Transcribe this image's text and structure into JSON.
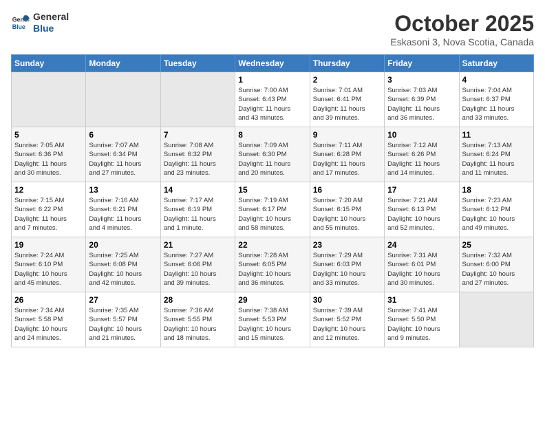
{
  "header": {
    "logo_line1": "General",
    "logo_line2": "Blue",
    "month": "October 2025",
    "location": "Eskasoni 3, Nova Scotia, Canada"
  },
  "days_of_week": [
    "Sunday",
    "Monday",
    "Tuesday",
    "Wednesday",
    "Thursday",
    "Friday",
    "Saturday"
  ],
  "weeks": [
    [
      {
        "day": "",
        "info": ""
      },
      {
        "day": "",
        "info": ""
      },
      {
        "day": "",
        "info": ""
      },
      {
        "day": "1",
        "info": "Sunrise: 7:00 AM\nSunset: 6:43 PM\nDaylight: 11 hours\nand 43 minutes."
      },
      {
        "day": "2",
        "info": "Sunrise: 7:01 AM\nSunset: 6:41 PM\nDaylight: 11 hours\nand 39 minutes."
      },
      {
        "day": "3",
        "info": "Sunrise: 7:03 AM\nSunset: 6:39 PM\nDaylight: 11 hours\nand 36 minutes."
      },
      {
        "day": "4",
        "info": "Sunrise: 7:04 AM\nSunset: 6:37 PM\nDaylight: 11 hours\nand 33 minutes."
      }
    ],
    [
      {
        "day": "5",
        "info": "Sunrise: 7:05 AM\nSunset: 6:36 PM\nDaylight: 11 hours\nand 30 minutes."
      },
      {
        "day": "6",
        "info": "Sunrise: 7:07 AM\nSunset: 6:34 PM\nDaylight: 11 hours\nand 27 minutes."
      },
      {
        "day": "7",
        "info": "Sunrise: 7:08 AM\nSunset: 6:32 PM\nDaylight: 11 hours\nand 23 minutes."
      },
      {
        "day": "8",
        "info": "Sunrise: 7:09 AM\nSunset: 6:30 PM\nDaylight: 11 hours\nand 20 minutes."
      },
      {
        "day": "9",
        "info": "Sunrise: 7:11 AM\nSunset: 6:28 PM\nDaylight: 11 hours\nand 17 minutes."
      },
      {
        "day": "10",
        "info": "Sunrise: 7:12 AM\nSunset: 6:26 PM\nDaylight: 11 hours\nand 14 minutes."
      },
      {
        "day": "11",
        "info": "Sunrise: 7:13 AM\nSunset: 6:24 PM\nDaylight: 11 hours\nand 11 minutes."
      }
    ],
    [
      {
        "day": "12",
        "info": "Sunrise: 7:15 AM\nSunset: 6:22 PM\nDaylight: 11 hours\nand 7 minutes."
      },
      {
        "day": "13",
        "info": "Sunrise: 7:16 AM\nSunset: 6:21 PM\nDaylight: 11 hours\nand 4 minutes."
      },
      {
        "day": "14",
        "info": "Sunrise: 7:17 AM\nSunset: 6:19 PM\nDaylight: 11 hours\nand 1 minute."
      },
      {
        "day": "15",
        "info": "Sunrise: 7:19 AM\nSunset: 6:17 PM\nDaylight: 10 hours\nand 58 minutes."
      },
      {
        "day": "16",
        "info": "Sunrise: 7:20 AM\nSunset: 6:15 PM\nDaylight: 10 hours\nand 55 minutes."
      },
      {
        "day": "17",
        "info": "Sunrise: 7:21 AM\nSunset: 6:13 PM\nDaylight: 10 hours\nand 52 minutes."
      },
      {
        "day": "18",
        "info": "Sunrise: 7:23 AM\nSunset: 6:12 PM\nDaylight: 10 hours\nand 49 minutes."
      }
    ],
    [
      {
        "day": "19",
        "info": "Sunrise: 7:24 AM\nSunset: 6:10 PM\nDaylight: 10 hours\nand 45 minutes."
      },
      {
        "day": "20",
        "info": "Sunrise: 7:25 AM\nSunset: 6:08 PM\nDaylight: 10 hours\nand 42 minutes."
      },
      {
        "day": "21",
        "info": "Sunrise: 7:27 AM\nSunset: 6:06 PM\nDaylight: 10 hours\nand 39 minutes."
      },
      {
        "day": "22",
        "info": "Sunrise: 7:28 AM\nSunset: 6:05 PM\nDaylight: 10 hours\nand 36 minutes."
      },
      {
        "day": "23",
        "info": "Sunrise: 7:29 AM\nSunset: 6:03 PM\nDaylight: 10 hours\nand 33 minutes."
      },
      {
        "day": "24",
        "info": "Sunrise: 7:31 AM\nSunset: 6:01 PM\nDaylight: 10 hours\nand 30 minutes."
      },
      {
        "day": "25",
        "info": "Sunrise: 7:32 AM\nSunset: 6:00 PM\nDaylight: 10 hours\nand 27 minutes."
      }
    ],
    [
      {
        "day": "26",
        "info": "Sunrise: 7:34 AM\nSunset: 5:58 PM\nDaylight: 10 hours\nand 24 minutes."
      },
      {
        "day": "27",
        "info": "Sunrise: 7:35 AM\nSunset: 5:57 PM\nDaylight: 10 hours\nand 21 minutes."
      },
      {
        "day": "28",
        "info": "Sunrise: 7:36 AM\nSunset: 5:55 PM\nDaylight: 10 hours\nand 18 minutes."
      },
      {
        "day": "29",
        "info": "Sunrise: 7:38 AM\nSunset: 5:53 PM\nDaylight: 10 hours\nand 15 minutes."
      },
      {
        "day": "30",
        "info": "Sunrise: 7:39 AM\nSunset: 5:52 PM\nDaylight: 10 hours\nand 12 minutes."
      },
      {
        "day": "31",
        "info": "Sunrise: 7:41 AM\nSunset: 5:50 PM\nDaylight: 10 hours\nand 9 minutes."
      },
      {
        "day": "",
        "info": ""
      }
    ]
  ]
}
